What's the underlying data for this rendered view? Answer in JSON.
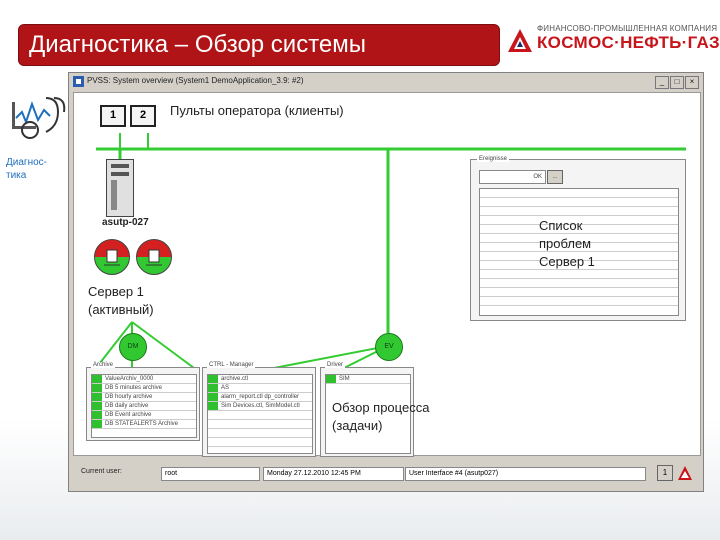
{
  "slide": {
    "title": "Диагностика – Обзор системы",
    "side_label_line1": "Диагнос-",
    "side_label_line2": "тика"
  },
  "logo": {
    "tagline": "ФИНАНСОВО-ПРОМЫШЛЕННАЯ КОМПАНИЯ",
    "name": "КОСМОС·НЕФТЬ·ГАЗ"
  },
  "window": {
    "title": "PVSS: System overview (System1  DemoApplication_3.9: #2)",
    "buttons": [
      "_",
      "□",
      "×"
    ]
  },
  "diagram": {
    "clients_label": "Пульты оператора (клиенты)",
    "monitor1": "1",
    "monitor2": "2",
    "server_host": "asutp-027",
    "server_label_line1": "Сервер 1",
    "server_label_line2": "(активный)",
    "problems_label_line1": "Список",
    "problems_label_line2": "проблем",
    "problems_label_line3": "Сервер 1",
    "process_label_line1": "Обзор процесса",
    "process_label_line2": "(задачи)",
    "node_dm": "DM",
    "node_ev": "EV",
    "problems_panel_title": "Ereignisse",
    "problems_ok": "OK",
    "problems_more": "...",
    "archive_title": "Archive",
    "archive_rows": [
      "ValueArchiv_0000",
      "DB 5 minutes archive",
      "DB hourly archive",
      "DB daily archive",
      "DB Event archive",
      "DB STATEALERTS Archive"
    ],
    "ctrl_title": "CTRL - Manager",
    "ctrl_rows": [
      "archive.ctl",
      "AS",
      "alarm_report.ctl dp_controller",
      "Sim Devices.ctl, SimModel.ctl"
    ],
    "driver_title": "Driver",
    "driver_rows": [
      "SIM"
    ]
  },
  "statusbar": {
    "current_user_label": "Current user:",
    "current_user": "root",
    "datetime": "Monday 27.12.2010      12:45 PM",
    "user_interface": "User Interface #4 (asutp027)",
    "page": "1"
  },
  "colors": {
    "title_bg": "#b01417",
    "accent_green": "#32c832",
    "alarm_red": "#d42020"
  }
}
